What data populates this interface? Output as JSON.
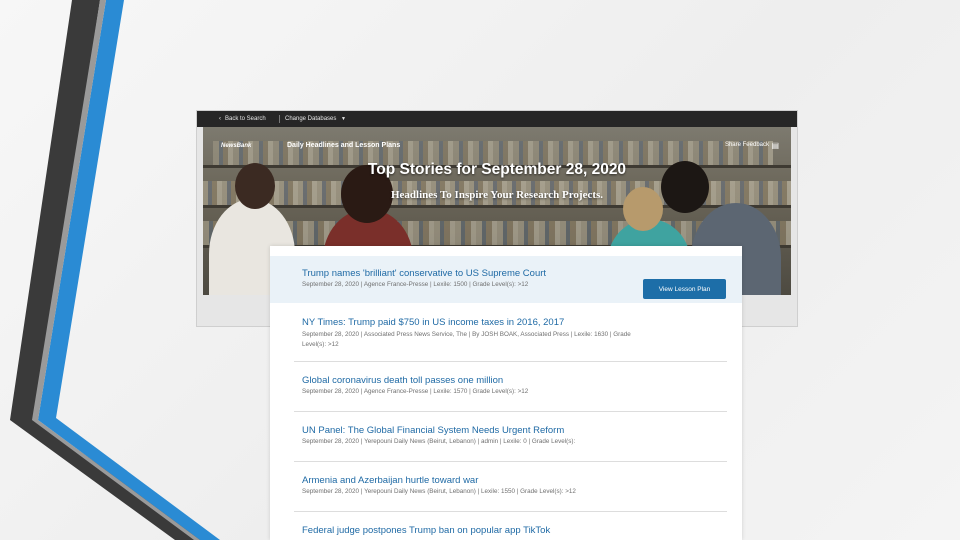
{
  "topbar": {
    "back_label": "Back to Search",
    "databases_label": "Change Databases",
    "databases_caret": "▼"
  },
  "hero": {
    "logo_text": "NewsBank",
    "product_name": "Daily Headlines and Lesson Plans",
    "share_feedback_label": "Share Feedback",
    "title": "Top Stories for September 28, 2020",
    "subtitle": "Headlines To Inspire Your Research Projects."
  },
  "lesson_plan_button_label": "View Lesson Plan",
  "articles": [
    {
      "title": "Trump names 'brilliant' conservative to US Supreme Court",
      "meta": "September 28, 2020 | Agence France-Presse | Lexile: 1500 | Grade Level(s): >12"
    },
    {
      "title": "NY Times: Trump paid $750 in US income taxes in 2016, 2017",
      "meta": "September 28, 2020 | Associated Press News Service, The | By JOSH BOAK, Associated Press | Lexile: 1630 | Grade Level(s): >12"
    },
    {
      "title": "Global coronavirus death toll passes one million",
      "meta": "September 28, 2020 | Agence France-Presse | Lexile: 1570 | Grade Level(s): >12"
    },
    {
      "title": "UN Panel: The Global Financial System Needs Urgent Reform",
      "meta": "September 28, 2020 | Yerepouni Daily News (Beirut, Lebanon) | admin | Lexile: 0 | Grade Level(s):"
    },
    {
      "title": "Armenia and Azerbaijan hurtle toward war",
      "meta": "September 28, 2020 | Yerepouni Daily News (Beirut, Lebanon) | Lexile: 1550 | Grade Level(s): >12"
    },
    {
      "title": "Federal judge postpones Trump ban on popular app TikTok",
      "meta": ""
    }
  ],
  "colors": {
    "accent_link": "#1f6aa5",
    "button": "#1d6ea8",
    "highlight_row": "#eaf2f8",
    "deco_blue": "#2a8bd4",
    "deco_dark": "#3a3a3a"
  },
  "icons": {
    "back": "chevron-left-icon",
    "dropdown": "caret-down-icon",
    "share": "feedback-icon"
  }
}
